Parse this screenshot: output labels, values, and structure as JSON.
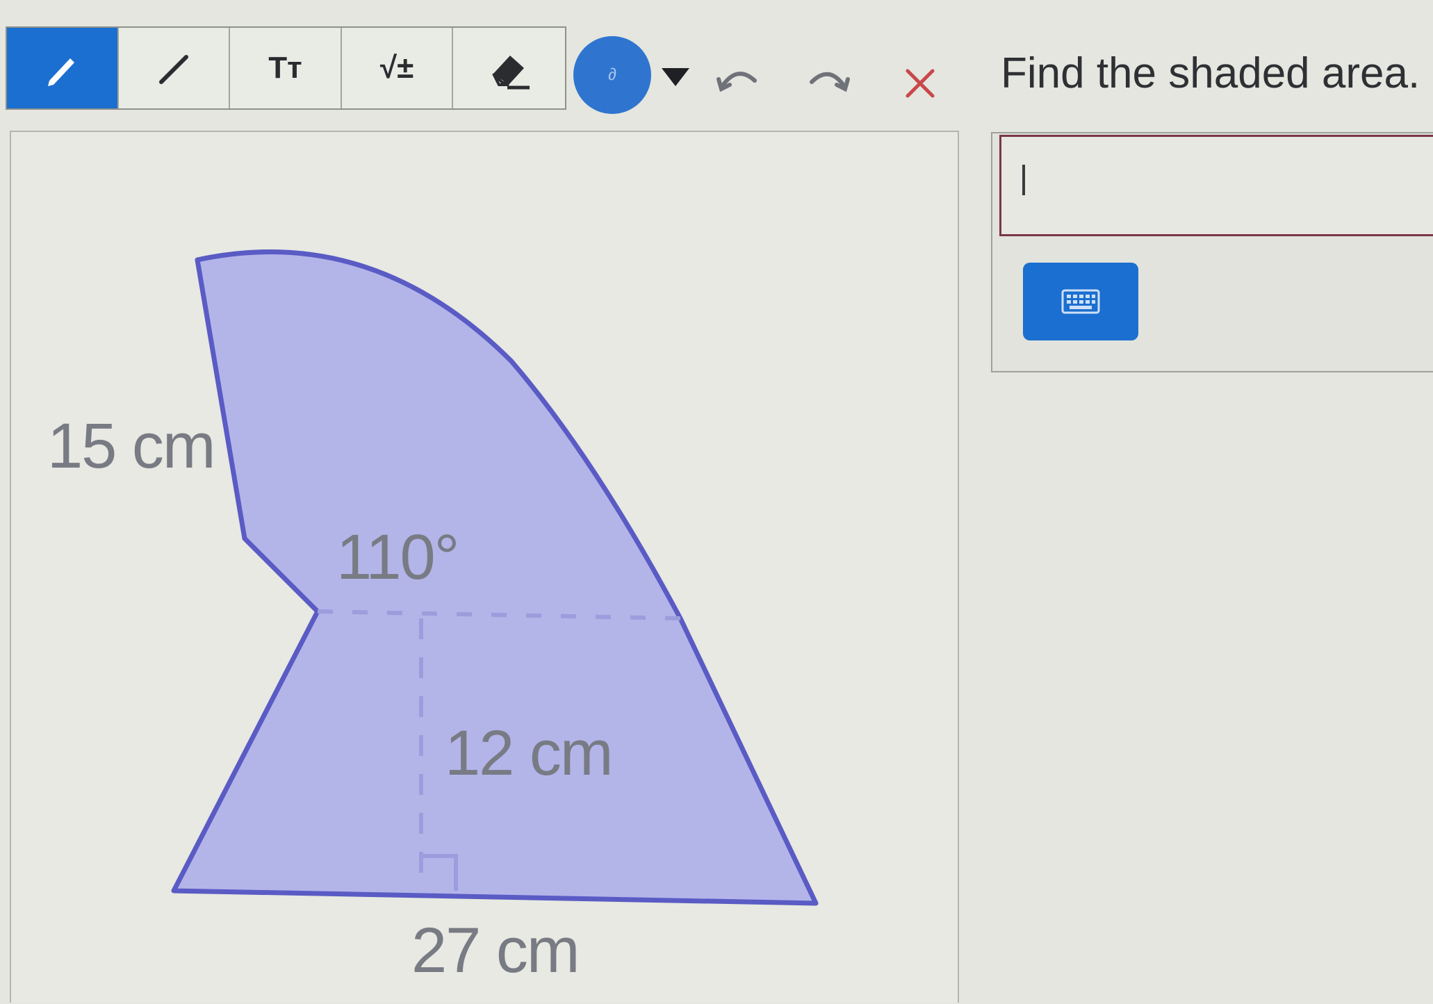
{
  "toolbar": {
    "tools": [
      {
        "name": "pencil",
        "active": true
      },
      {
        "name": "line",
        "active": false
      },
      {
        "name": "text",
        "glyph": "Tт",
        "active": false
      },
      {
        "name": "equation",
        "glyph": "√±",
        "active": false
      },
      {
        "name": "eraser",
        "active": false
      }
    ],
    "color_swatch": {
      "color": "#2f75cf",
      "glyph": "∂"
    },
    "icons": [
      "chevron-down-icon",
      "undo-icon",
      "redo-icon",
      "close-icon"
    ]
  },
  "figure": {
    "labels": {
      "side": "15 cm",
      "angle": "110°",
      "height": "12 cm",
      "base": "27 cm"
    },
    "shape_fill": "#b3b5e9",
    "shape_stroke": "#5a5bc4"
  },
  "question": {
    "prompt": "Find the shaded area."
  },
  "answer": {
    "value": "",
    "keyboard_icon": "keyboard-icon"
  },
  "colors": {
    "accent": "#1b6fd0",
    "input_border": "#7a3646"
  }
}
